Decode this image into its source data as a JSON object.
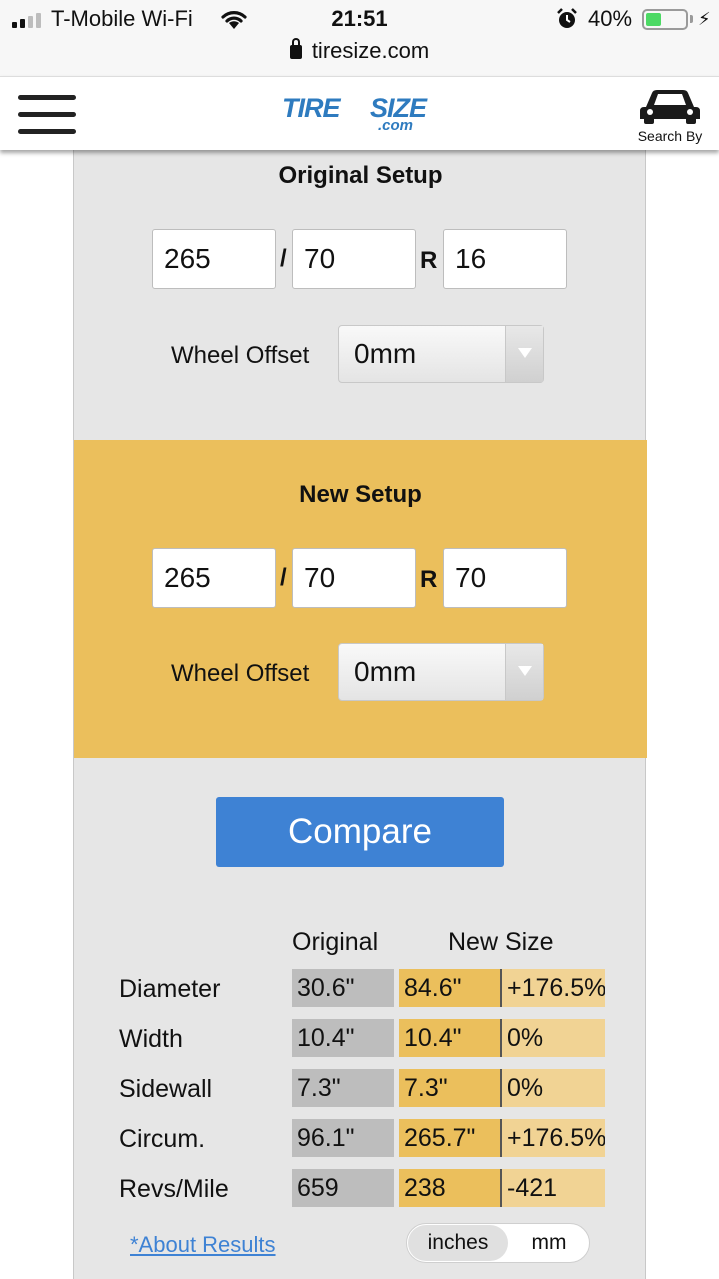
{
  "status_bar": {
    "carrier": "T-Mobile Wi-Fi",
    "time": "21:51",
    "battery_pct": "40%",
    "battery_level": 0.4,
    "url": "tiresize.com"
  },
  "header": {
    "logo_tire": "TIRE",
    "logo_size": "SIZE",
    "logo_com": ".com",
    "search_by": "Search By"
  },
  "original_setup": {
    "title": "Original Setup",
    "width": "265",
    "separator": "/",
    "aspect": "70",
    "construction": "R",
    "rim": "16",
    "offset_label": "Wheel Offset",
    "offset_value": "0mm"
  },
  "new_setup": {
    "title": "New Setup",
    "width": "265",
    "separator": "/",
    "aspect": "70",
    "construction": "R",
    "rim": "70",
    "offset_label": "Wheel Offset",
    "offset_value": "0mm"
  },
  "compare_label": "Compare",
  "results": {
    "col_original": "Original",
    "col_new": "New Size",
    "rows": [
      {
        "label": "Diameter",
        "original": "30.6\"",
        "new": "84.6\"",
        "diff": "+176.5%"
      },
      {
        "label": "Width",
        "original": "10.4\"",
        "new": "10.4\"",
        "diff": "0%"
      },
      {
        "label": "Sidewall",
        "original": "7.3\"",
        "new": "7.3\"",
        "diff": "0%"
      },
      {
        "label": "Circum.",
        "original": "96.1\"",
        "new": "265.7\"",
        "diff": "+176.5%"
      },
      {
        "label": "Revs/Mile",
        "original": "659",
        "new": "238",
        "diff": "-421"
      }
    ]
  },
  "about_link": "*About Results",
  "units": {
    "active": "inches",
    "other": "mm"
  },
  "colors": {
    "new_setup_bg": "#ebbf5c",
    "compare_btn": "#3e82d4",
    "panel_bg": "#e6e6e6",
    "battery_green": "#4cd964"
  }
}
